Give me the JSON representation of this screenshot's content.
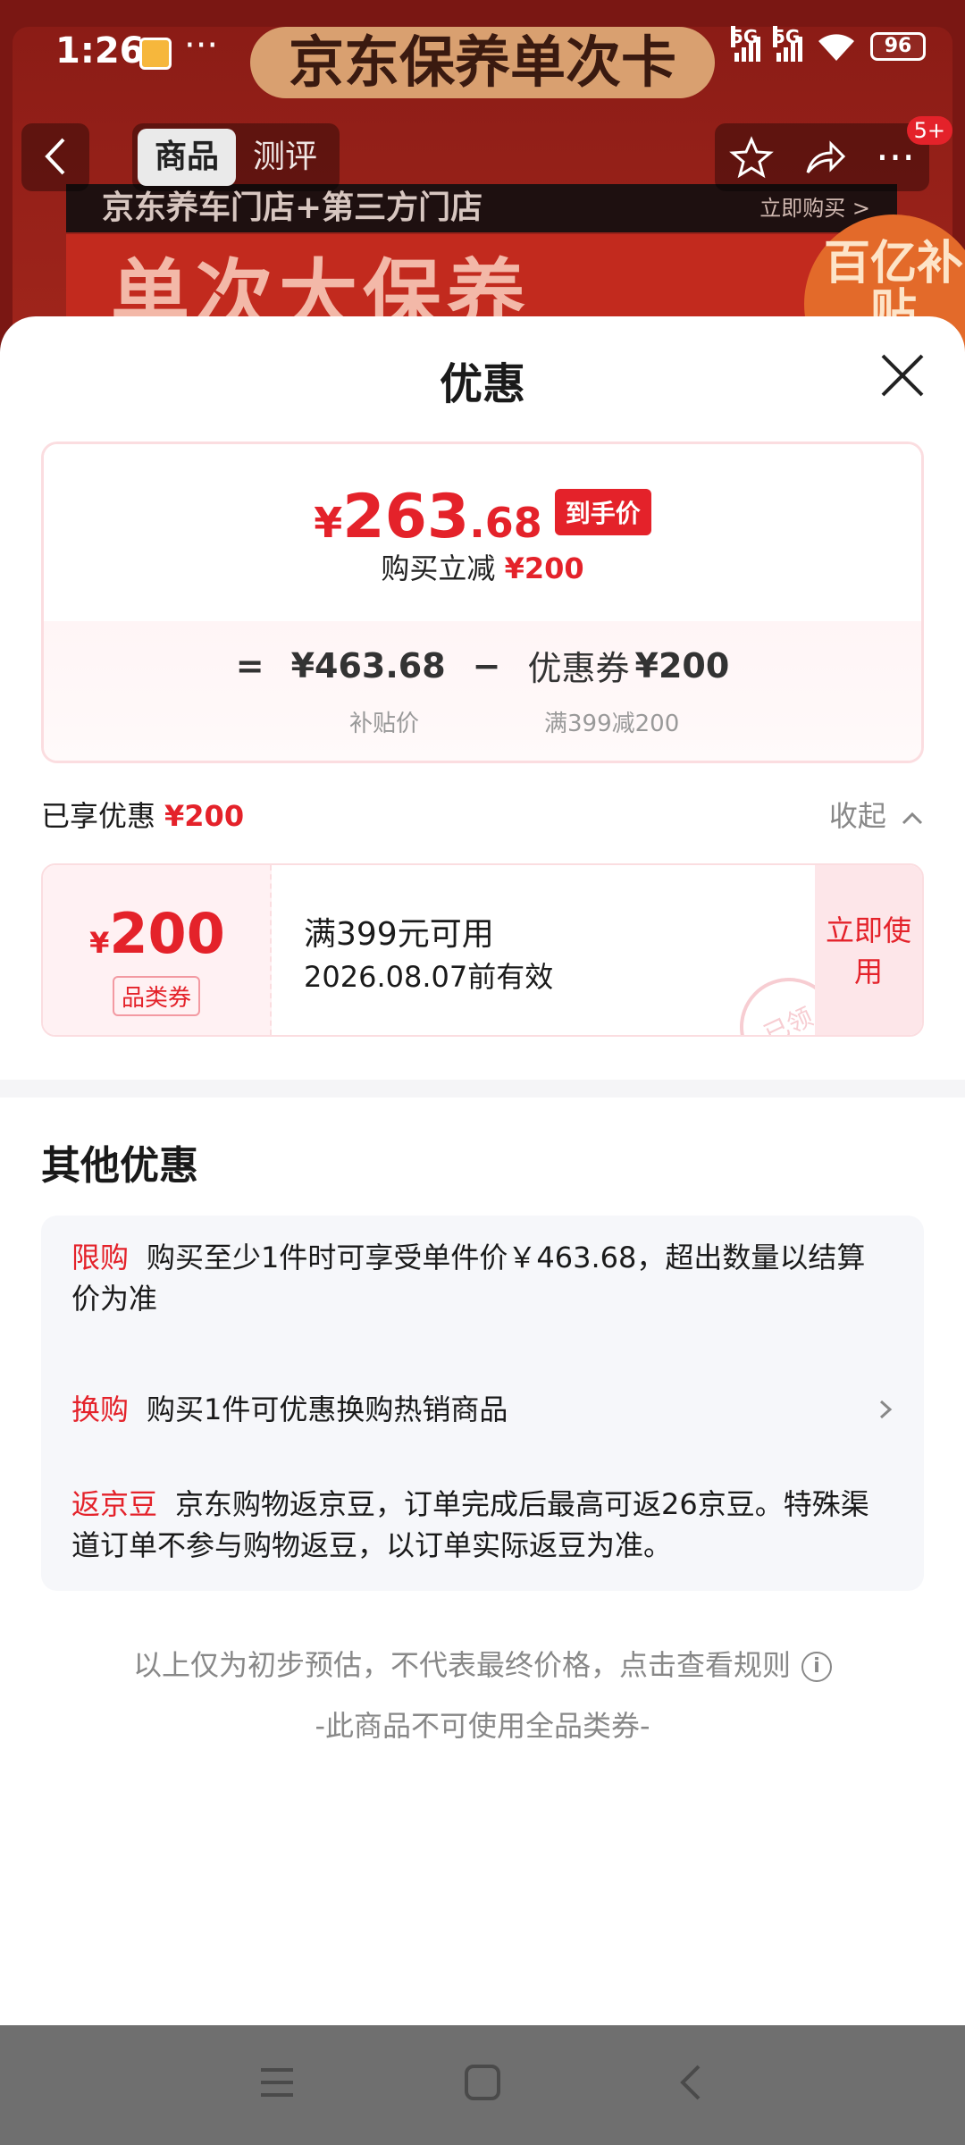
{
  "status_bar": {
    "time": "1:26",
    "dots": "···",
    "signal_1": "5G",
    "signal_2": "5G",
    "battery": "96"
  },
  "background_page": {
    "banner_title": "京东保养单次卡",
    "strip_text": "京东养车门店+第三方门店",
    "strip_sub": "立即购买 >",
    "big_text": "单次大保养",
    "badge_text": "百亿补贴"
  },
  "top_nav": {
    "tabs": [
      {
        "label": "商品",
        "active": true
      },
      {
        "label": "测评",
        "active": false
      }
    ],
    "badge": "5+"
  },
  "sheet": {
    "title": "优惠",
    "price_card": {
      "currency": "¥",
      "final_int": "263",
      "final_dec": ".68",
      "final_tag": "到手价",
      "reduce_label": "购买立减",
      "reduce_amount": "¥200",
      "eq": "=",
      "subsidy_price": "¥463.68",
      "minus": "−",
      "coupon_label": "优惠券",
      "coupon_amount": "¥200",
      "subsidy_label": "补贴价",
      "coupon_rule": "满399减200"
    },
    "enjoyed": {
      "label": "已享优惠",
      "amount": "¥200",
      "collapse": "收起"
    },
    "coupon": {
      "currency": "¥",
      "value": "200",
      "type": "品类券",
      "condition": "满399元可用",
      "valid_until": "2026.08.07前有效",
      "stamp": "已领",
      "use_button": "立即使用"
    },
    "other": {
      "title": "其他优惠",
      "items": [
        {
          "tag": "限购",
          "text": "购买至少1件时可享受单件价￥463.68，超出数量以结算价为准"
        },
        {
          "tag": "换购",
          "text": "购买1件可优惠换购热销商品"
        },
        {
          "tag": "返京豆",
          "text": "京东购物返京豆，订单完成后最高可返26京豆。特殊渠道订单不参与购物返豆，以订单实际返豆为准。"
        }
      ]
    },
    "foot_note": "以上仅为初步预估，不代表最终价格，点击查看规则",
    "foot_note2": "-此商品不可使用全品类券-"
  },
  "colors": {
    "accent_red": "#e4222a",
    "nav_bar": "#6f6f6f"
  }
}
